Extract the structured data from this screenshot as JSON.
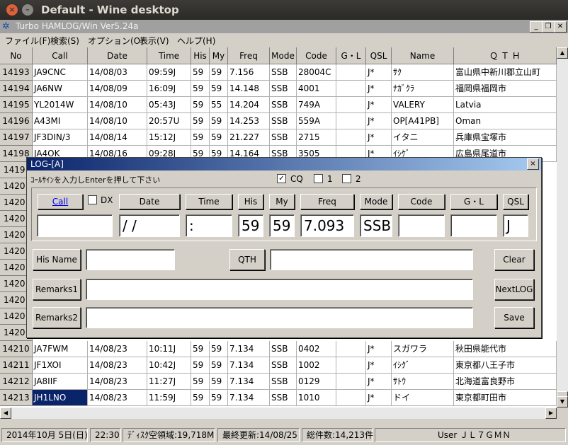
{
  "window": {
    "title": "Default - Wine desktop",
    "close": "×",
    "minimize": "–"
  },
  "app": {
    "title": "Turbo HAMLOG/Win Ver5.24a",
    "ctl_min": "_",
    "ctl_restore": "❐",
    "ctl_close": "✕"
  },
  "menu": [
    "ファイル(F)",
    "検索(S)",
    "オプション(O)",
    "表示(V)",
    "ヘルプ(H)"
  ],
  "columns": [
    "No",
    "Call",
    "Date",
    "Time",
    "His",
    "My",
    "Freq",
    "Mode",
    "Code",
    "G・L",
    "QSL",
    "Name",
    "Ｑ Ｔ Ｈ"
  ],
  "rows_top": [
    {
      "no": "14193",
      "call": "JA9CNC",
      "date": "14/08/03",
      "time": "09:59J",
      "his": "59",
      "my": "59",
      "freq": "7.156",
      "mode": "SSB",
      "code": "28004C",
      "gl": "",
      "qsl": "J*",
      "name": "ｻｸ",
      "qth": "富山県中新川郡立山町"
    },
    {
      "no": "14194",
      "call": "JA6NW",
      "date": "14/08/09",
      "time": "16:09J",
      "his": "59",
      "my": "59",
      "freq": "14.148",
      "mode": "SSB",
      "code": "4001",
      "gl": "",
      "qsl": "J*",
      "name": "ﾅｶﾞｸﾗ",
      "qth": "福岡県福岡市"
    },
    {
      "no": "14195",
      "call": "YL2014W",
      "date": "14/08/10",
      "time": "05:43J",
      "his": "59",
      "my": "55",
      "freq": "14.204",
      "mode": "SSB",
      "code": "749A",
      "gl": "",
      "qsl": "J*",
      "name": "VALERY",
      "qth": "Latvia"
    },
    {
      "no": "14196",
      "call": "A43MI",
      "date": "14/08/10",
      "time": "20:57U",
      "his": "59",
      "my": "59",
      "freq": "14.253",
      "mode": "SSB",
      "code": "559A",
      "gl": "",
      "qsl": "J*",
      "name": "OP[A41PB]",
      "qth": "Oman"
    },
    {
      "no": "14197",
      "call": "JF3DIN/3",
      "date": "14/08/14",
      "time": "15:12J",
      "his": "59",
      "my": "59",
      "freq": "21.227",
      "mode": "SSB",
      "code": "2715",
      "gl": "",
      "qsl": "J*",
      "name": "イタニ",
      "qth": "兵庫県宝塚市"
    },
    {
      "no": "14198",
      "call": "JA4OK",
      "date": "14/08/16",
      "time": "09:28J",
      "his": "59",
      "my": "59",
      "freq": "14.164",
      "mode": "SSB",
      "code": "3505",
      "gl": "",
      "qsl": "J*",
      "name": "ｲｼｹﾞ",
      "qth": "広島県尾道市"
    }
  ],
  "hidden_row_numbers": [
    "1419",
    "1420",
    "1420",
    "1420",
    "1420",
    "1420",
    "1420",
    "1420",
    "1420",
    "1420",
    "1420"
  ],
  "rows_bottom": [
    {
      "no": "14210",
      "call": "JA7FWM",
      "date": "14/08/23",
      "time": "10:11J",
      "his": "59",
      "my": "59",
      "freq": "7.134",
      "mode": "SSB",
      "code": "0402",
      "gl": "",
      "qsl": "J*",
      "name": "スガワラ",
      "qth": "秋田県能代市"
    },
    {
      "no": "14211",
      "call": "JF1XOI",
      "date": "14/08/23",
      "time": "10:42J",
      "his": "59",
      "my": "59",
      "freq": "7.134",
      "mode": "SSB",
      "code": "1002",
      "gl": "",
      "qsl": "J*",
      "name": "ｲｼｸﾞ",
      "qth": "東京都八王子市"
    },
    {
      "no": "14212",
      "call": "JA8IIF",
      "date": "14/08/23",
      "time": "11:27J",
      "his": "59",
      "my": "59",
      "freq": "7.134",
      "mode": "SSB",
      "code": "0129",
      "gl": "",
      "qsl": "J*",
      "name": "ｻﾄｳ",
      "qth": "北海道富良野市"
    },
    {
      "no": "14213",
      "call": "JH1LNO",
      "date": "14/08/23",
      "time": "11:59J",
      "his": "59",
      "my": "59",
      "freq": "7.134",
      "mode": "SSB",
      "code": "1010",
      "gl": "",
      "qsl": "J*",
      "name": "ドイ",
      "qth": "東京都町田市"
    }
  ],
  "dialog": {
    "title": "LOG-[A]",
    "close": "×",
    "prompt": "ｺｰﾙｻｲﾝを入力しEnterを押して下さい",
    "cq_label": "CQ",
    "cq_checked": "✓",
    "opt1_label": "1",
    "opt2_label": "2",
    "dx_label": "DX",
    "buttons": {
      "call": "Call",
      "date": "Date",
      "time": "Time",
      "his": "His",
      "my": "My",
      "freq": "Freq",
      "mode": "Mode",
      "code": "Code",
      "gl": "G・L",
      "qsl": "QSL",
      "his_name": "His Name",
      "qth": "QTH",
      "clear": "Clear",
      "remarks1": "Remarks1",
      "nextlog": "NextLOG",
      "remarks2": "Remarks2",
      "save": "Save"
    },
    "values": {
      "call": "",
      "date": " /  /",
      "time": " :",
      "his": "59",
      "my": "59",
      "freq": "7.093",
      "mode": "SSB",
      "code": "",
      "gl": "",
      "qsl": "J",
      "his_name": "",
      "qth": "",
      "remarks1": "",
      "remarks2": ""
    }
  },
  "status": {
    "date": "2014年10月 5日(日)",
    "time": "22:30",
    "disk": "ﾃﾞｨｽｸ空領域:19,718M",
    "updated": "最終更新:14/08/25",
    "total": "総件数:14,213件",
    "user": "User ＪＬ７ＧＭＮ"
  }
}
